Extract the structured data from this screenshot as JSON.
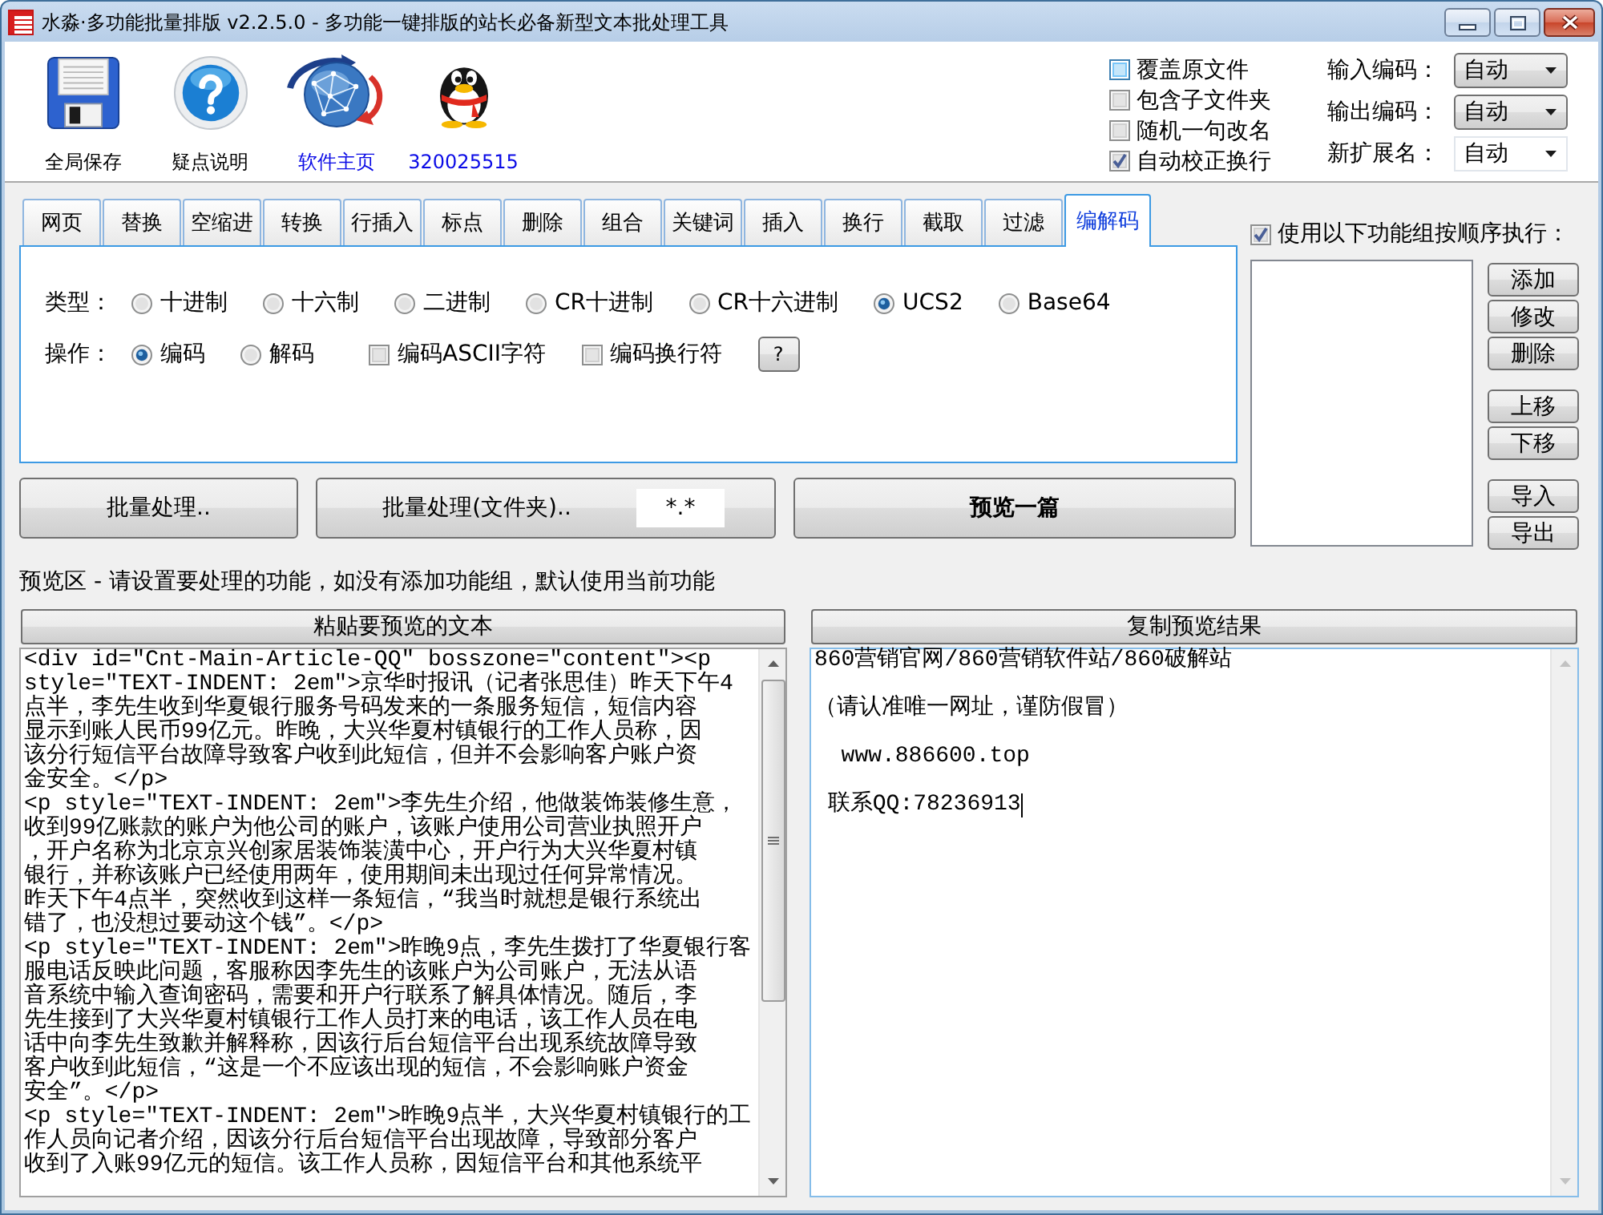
{
  "window": {
    "title": "水淼·多功能批量排版 v2.2.5.0 - 多功能一键排版的站长必备新型文本批处理工具"
  },
  "toolbar": {
    "items": [
      {
        "label": "全局保存",
        "kind": "button"
      },
      {
        "label": "疑点说明",
        "kind": "button"
      },
      {
        "label": "软件主页",
        "kind": "link"
      },
      {
        "label": "320025515",
        "kind": "link"
      }
    ]
  },
  "options": {
    "checkboxes": [
      {
        "label": "覆盖原文件",
        "checked": false,
        "hovered": true
      },
      {
        "label": "包含子文件夹",
        "checked": false,
        "hovered": false
      },
      {
        "label": "随机一句改名",
        "checked": false,
        "hovered": false
      },
      {
        "label": "自动校正换行",
        "checked": true,
        "hovered": false
      }
    ],
    "encodings": [
      {
        "label": "输入编码：",
        "value": "自动",
        "kind": "dropdown"
      },
      {
        "label": "输出编码：",
        "value": "自动",
        "kind": "dropdown"
      },
      {
        "label": "新扩展名：",
        "value": "自动",
        "kind": "combo"
      }
    ]
  },
  "tabs": [
    {
      "label": "网页",
      "selected": false
    },
    {
      "label": "替换",
      "selected": false
    },
    {
      "label": "空缩进",
      "selected": false
    },
    {
      "label": "转换",
      "selected": false
    },
    {
      "label": "行插入",
      "selected": false
    },
    {
      "label": "标点",
      "selected": false
    },
    {
      "label": "删除",
      "selected": false
    },
    {
      "label": "组合",
      "selected": false
    },
    {
      "label": "关键词",
      "selected": false
    },
    {
      "label": "插入",
      "selected": false
    },
    {
      "label": "换行",
      "selected": false
    },
    {
      "label": "截取",
      "selected": false
    },
    {
      "label": "过滤",
      "selected": false
    },
    {
      "label": "编解码",
      "selected": true
    }
  ],
  "codec_panel": {
    "type_label": "类型：",
    "types": [
      {
        "label": "十进制",
        "selected": false
      },
      {
        "label": "十六制",
        "selected": false
      },
      {
        "label": "二进制",
        "selected": false
      },
      {
        "label": "CR十进制",
        "selected": false
      },
      {
        "label": "CR十六进制",
        "selected": false
      },
      {
        "label": "UCS2",
        "selected": true
      },
      {
        "label": "Base64",
        "selected": false
      }
    ],
    "operation_label": "操作：",
    "operations": [
      {
        "label": "编码",
        "selected": true
      },
      {
        "label": "解码",
        "selected": false
      }
    ],
    "flags": [
      {
        "label": "编码ASCII字符",
        "checked": false
      },
      {
        "label": "编码换行符",
        "checked": false
      }
    ],
    "help_button": "?"
  },
  "actions": [
    {
      "label": "批量处理..",
      "kind": "button"
    },
    {
      "label": "批量处理(文件夹)..",
      "kind": "with_field",
      "field_value": "*.*"
    },
    {
      "label": "预览一篇",
      "kind": "primary"
    }
  ],
  "function_groups": {
    "use_in_order": {
      "label": "使用以下功能组按顺序执行：",
      "checked": true
    },
    "button_groups": [
      [
        "添加",
        "修改",
        "删除"
      ],
      [
        "上移",
        "下移"
      ],
      [
        "导入",
        "导出"
      ]
    ]
  },
  "preview": {
    "hint": "预览区 - 请设置要处理的功能，如没有添加功能组，默认使用当前功能",
    "source": {
      "button": "粘贴要预览的文本",
      "lines": [
        "<div id=\"Cnt-Main-Article-QQ\" bosszone=\"content\"><p",
        "style=\"TEXT-INDENT: 2em\">京华时报讯（记者张思佳）昨天下午4",
        "点半，李先生收到华夏银行服务号码发来的一条服务短信，短信内容",
        "显示到账人民币99亿元。昨晚，大兴华夏村镇银行的工作人员称，因",
        "该分行短信平台故障导致客户收到此短信，但并不会影响客户账户资",
        "金安全。</p>",
        "<p style=\"TEXT-INDENT: 2em\">李先生介绍，他做装饰装修生意，",
        "收到99亿账款的账户为他公司的账户，该账户使用公司营业执照开户",
        "，开户名称为北京京兴创家居装饰装潢中心，开户行为大兴华夏村镇",
        "银行，并称该账户已经使用两年，使用期间未出现过任何异常情况。",
        "昨天下午4点半，突然收到这样一条短信，“我当时就想是银行系统出",
        "错了，也没想过要动这个钱”。</p>",
        "<p style=\"TEXT-INDENT: 2em\">昨晚9点，李先生拨打了华夏银行客",
        "服电话反映此问题，客服称因李先生的该账户为公司账户，无法从语",
        "音系统中输入查询密码，需要和开户行联系了解具体情况。随后，李",
        "先生接到了大兴华夏村镇银行工作人员打来的电话，该工作人员在电",
        "话中向李先生致歉并解释称，因该行后台短信平台出现系统故障导致",
        "客户收到此短信，“这是一个不应该出现的短信，不会影响账户资金",
        "安全”。</p>",
        "<p style=\"TEXT-INDENT: 2em\">昨晚9点半，大兴华夏村镇银行的工",
        "作人员向记者介绍，因该分行后台短信平台出现故障，导致部分客户",
        "收到了入账99亿元的短信。该工作人员称，因短信平台和其他系统平"
      ],
      "scrollbar_enabled": true
    },
    "result": {
      "button": "复制预览结果",
      "lines": [
        "860营销官网/860营销软件站/860破解站",
        "（请认准唯一网址，谨防假冒）",
        "  www.886600.top",
        " 联系QQ:78236913"
      ],
      "caret": true,
      "scrollbar_enabled": false
    }
  }
}
